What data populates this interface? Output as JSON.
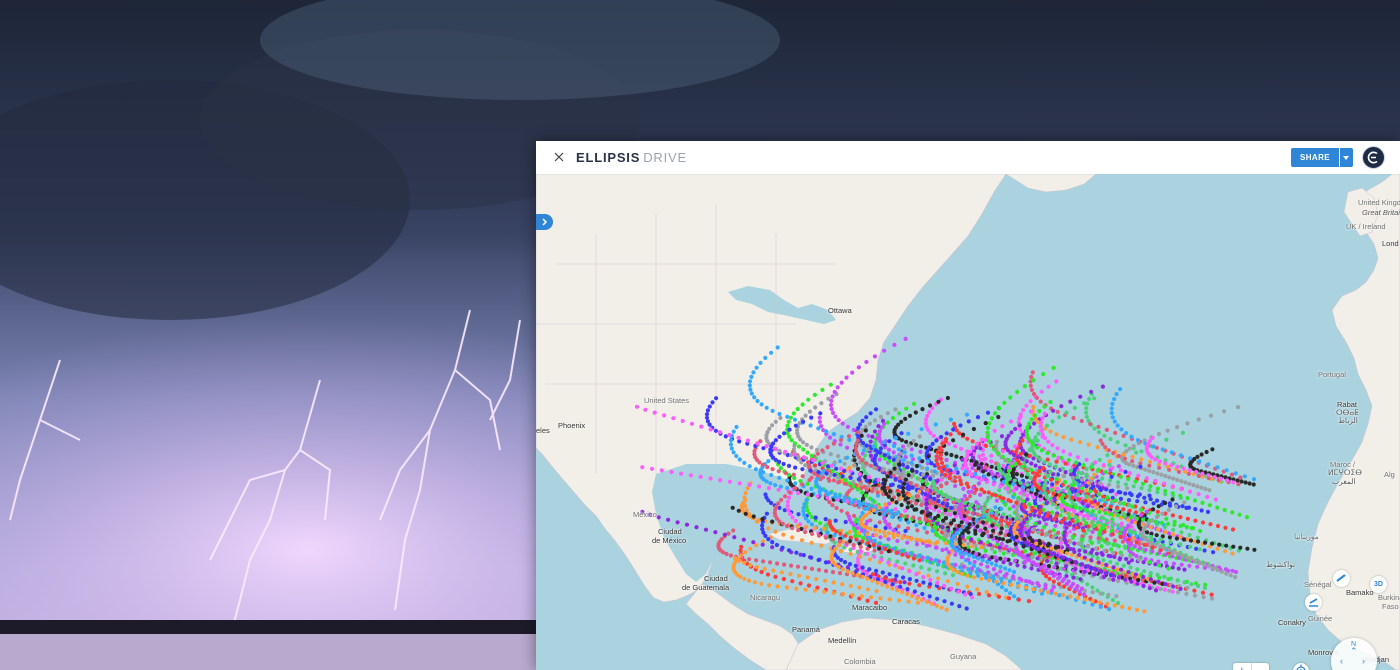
{
  "app": {
    "logo_text": "ELLIPSIS",
    "logo_sub": "DRIVE",
    "share_label": "SHARE"
  },
  "icons": {
    "close": "close-icon",
    "dropdown": "chevron-down-icon",
    "avatar": "user-avatar-icon",
    "sidebar": "chevron-right-icon",
    "locate": "locate-icon",
    "measure": "ruler-icon",
    "mode3d": "3d-icon",
    "draw": "draw-icon",
    "nav": "navigation-pad-icon"
  },
  "controls": {
    "zoom_in": "+",
    "zoom_out": "−",
    "mode3d": "3D",
    "nav_north": "N"
  },
  "map": {
    "labels": [
      {
        "id": "united-kingdom",
        "text": "United Kingdom"
      },
      {
        "id": "great-britain",
        "text": "Great Britain"
      },
      {
        "id": "uk-ireland",
        "text": "UK / Ireland"
      },
      {
        "id": "london",
        "text": "Lond"
      },
      {
        "id": "ottawa",
        "text": "Ottawa"
      },
      {
        "id": "united-states",
        "text": "United States"
      },
      {
        "id": "phoenix",
        "text": "Phoenix"
      },
      {
        "id": "angeles",
        "text": "eles"
      },
      {
        "id": "portugal",
        "text": "Portugal"
      },
      {
        "id": "rabat",
        "text": "Rabat"
      },
      {
        "id": "rabat-ar",
        "text": "الرباط"
      },
      {
        "id": "rabat-tf",
        "text": "ⵔⴱⴰⵟ"
      },
      {
        "id": "maroc",
        "text": "Maroc /"
      },
      {
        "id": "maroc-tf",
        "text": "ⵍⵎⵖⵔⵉⴱ"
      },
      {
        "id": "maroc-ar",
        "text": "المغرب"
      },
      {
        "id": "alg",
        "text": "Alg"
      },
      {
        "id": "mauritania",
        "text": "موريتانيا"
      },
      {
        "id": "mexico",
        "text": "México"
      },
      {
        "id": "ciudad-mexico",
        "text": "Ciudad"
      },
      {
        "id": "ciudad-mexico-2",
        "text": "de México"
      },
      {
        "id": "ciudad-guatemala",
        "text": "Ciudad"
      },
      {
        "id": "ciudad-guatemala-2",
        "text": "de Guatemala"
      },
      {
        "id": "nicaragua",
        "text": "Nicaragu"
      },
      {
        "id": "maracaibo",
        "text": "Maracaibo"
      },
      {
        "id": "caracas",
        "text": "Caracas"
      },
      {
        "id": "panama",
        "text": "Panamá"
      },
      {
        "id": "medellin",
        "text": "Medellín"
      },
      {
        "id": "colombia",
        "text": "Colombia"
      },
      {
        "id": "guyana",
        "text": "Guyana"
      },
      {
        "id": "senegal",
        "text": "Sénégal"
      },
      {
        "id": "nouakchott",
        "text": "نواكشوط"
      },
      {
        "id": "bamako",
        "text": "Bamako"
      },
      {
        "id": "burkina",
        "text": "Burkina"
      },
      {
        "id": "faso",
        "text": "Faso"
      },
      {
        "id": "guinee",
        "text": "Guinée"
      },
      {
        "id": "conakry",
        "text": "Conakry"
      },
      {
        "id": "monrovia",
        "text": "Monrovia"
      },
      {
        "id": "abidjan",
        "text": "Abidjan"
      }
    ]
  },
  "colors": {
    "accent": "#2f86d6",
    "ocean": "#aad3df",
    "land": "#f2efe9",
    "track_palette": [
      "#ff3a3a",
      "#2ee82e",
      "#3a3aff",
      "#ff5cff",
      "#9aa0a6",
      "#2a2a2a",
      "#c94dff",
      "#33aaff",
      "#4cd17a",
      "#8a2be2",
      "#e05a7a",
      "#ff9a3a"
    ]
  }
}
